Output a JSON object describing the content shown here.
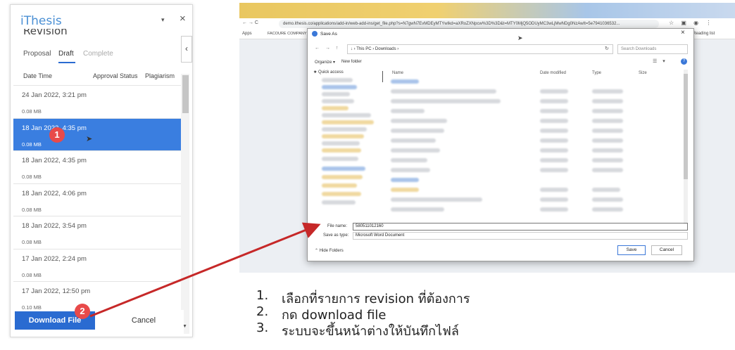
{
  "left_panel": {
    "title": "iThesis",
    "dropdown_glyph": "▾",
    "close_glyph": "×",
    "subtitle": "Revision",
    "collapse_glyph": "‹",
    "tabs": [
      {
        "label": "Proposal"
      },
      {
        "label": "Draft",
        "active": true
      },
      {
        "label": "Complete"
      }
    ],
    "columns": {
      "date": "Date Time",
      "approval": "Approval Status",
      "plagiarism": "Plagiarism"
    },
    "revisions": [
      {
        "date": "24 Jan 2022, 3:21 pm",
        "size": "0.08 MB",
        "selected": false
      },
      {
        "date": "18 Jan 2022, 4:35 pm",
        "size": "0.08 MB",
        "selected": true
      },
      {
        "date": "18 Jan 2022, 4:35 pm",
        "size": "0.08 MB",
        "selected": false
      },
      {
        "date": "18 Jan 2022, 4:06 pm",
        "size": "0.08 MB",
        "selected": false
      },
      {
        "date": "18 Jan 2022, 3:54 pm",
        "size": "0.08 MB",
        "selected": false
      },
      {
        "date": "17 Jan 2022, 2:24 pm",
        "size": "0.08 MB",
        "selected": false
      },
      {
        "date": "17 Jan 2022, 12:50 pm",
        "size": "0.10 MB",
        "selected": false
      }
    ],
    "download_label": "Download File",
    "cancel_label": "Cancel",
    "scroll_down_glyph": "▼"
  },
  "badges": {
    "one": "1",
    "two": "2",
    "accent": "#e84a4a"
  },
  "browser": {
    "nav_glyphs": "← → C",
    "url": "demo.ithesis.co/applications/add-in/web-add-ins/get_file.php?s=N7gwN7EvMDEyMTYwIkd=aXRoZXNpcw%3D%3D&t=MTY0MjQ5ODUyMC3wLjMwNDg0NzAwIt=5e7941036532...",
    "toolbar_icons": "☆ ▣ ◉ ⋮",
    "bookmarks": {
      "apps": "Apps",
      "facoure": "FACOURE COMPANY",
      "reading": "Reading list"
    }
  },
  "dialog": {
    "title": "Save As",
    "close_glyph": "×",
    "nav_glyphs": "← → ↑",
    "path": "↓ › This PC › Downloads ›",
    "refresh_glyph": "↻",
    "search_placeholder": "Search Downloads",
    "organize": "Organize ▾",
    "new_folder": "New folder",
    "view_glyphs": "☰ ▾",
    "help_glyph": "?",
    "quick_access": "★ Quick access",
    "columns": {
      "name": "Name",
      "modified": "Date modified",
      "type": "Type",
      "size": "Size"
    },
    "file_name_label": "File name:",
    "file_name_value": "580511012160",
    "save_type_label": "Save as type:",
    "save_type_value": "Microsoft Word Document",
    "hide_folders": "⌃ Hide Folders",
    "save_label": "Save",
    "cancel_label": "Cancel"
  },
  "instructions": [
    {
      "num": "1.",
      "text": "เลือกที่รายการ revision ที่ต้องการ"
    },
    {
      "num": "2.",
      "text": "กด download file"
    },
    {
      "num": "3.",
      "text": "ระบบจะขึ้นหน้าต่างให้บันทึกไฟล์"
    }
  ],
  "colors": {
    "accent": "#2a6bd1",
    "selection": "#3a7ee0",
    "arrow": "#c62828"
  }
}
